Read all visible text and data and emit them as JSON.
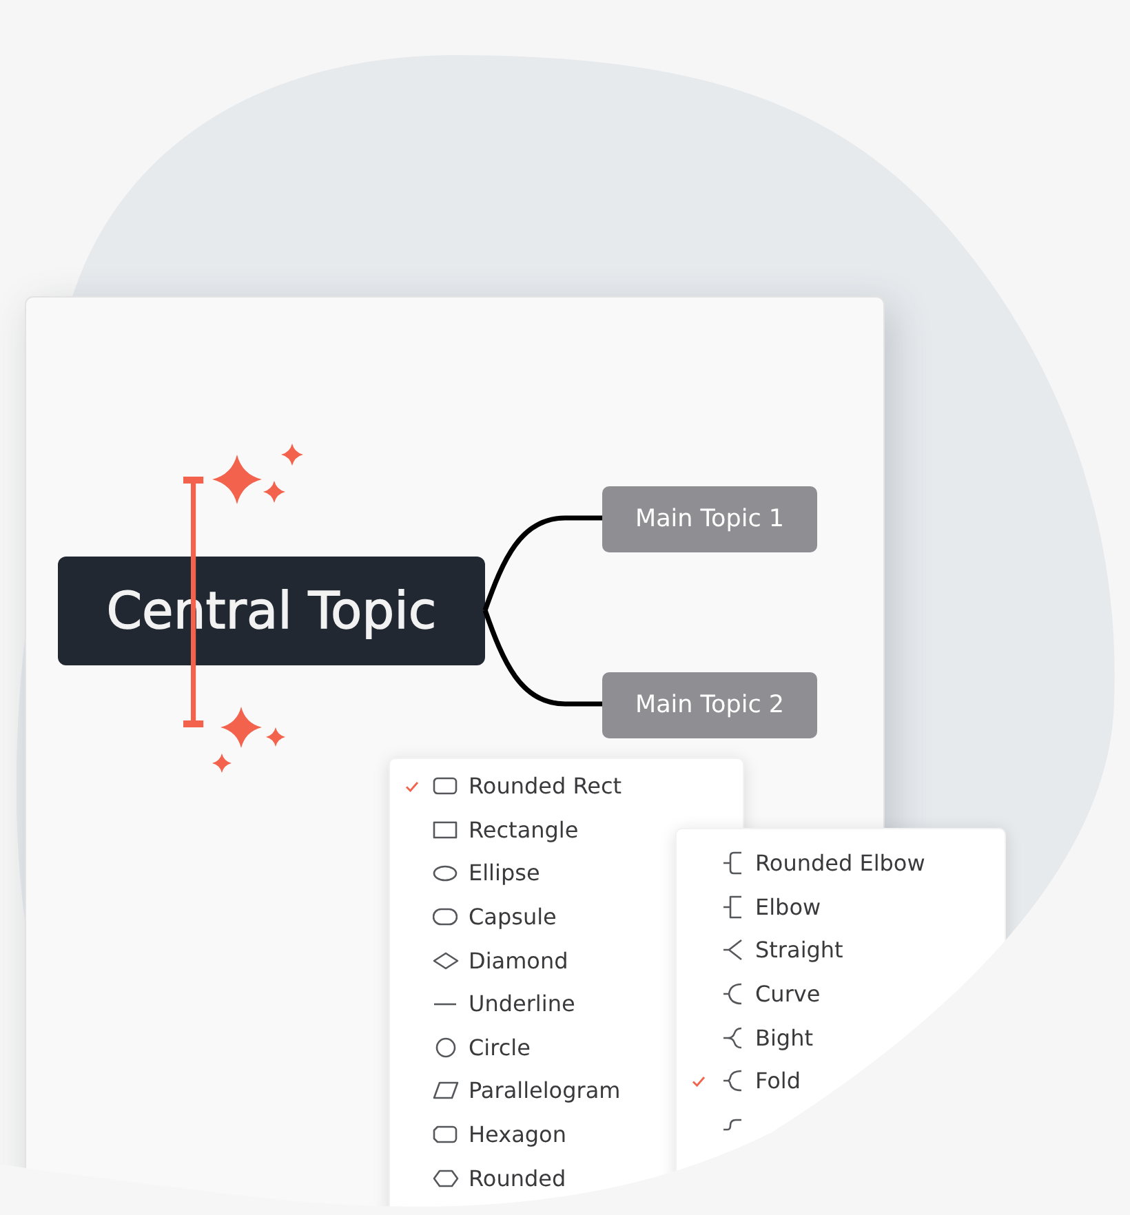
{
  "canvas": {
    "central_topic": {
      "label": "Central Topic"
    },
    "main_topics": [
      {
        "label": "Main Topic 1"
      },
      {
        "label": "Main Topic 2"
      }
    ]
  },
  "menus": [
    {
      "items": [
        {
          "label": "Rounded Rect",
          "kind": "roundrect",
          "selected": true
        },
        {
          "label": "Rectangle",
          "kind": "rect",
          "selected": false
        },
        {
          "label": "Ellipse",
          "kind": "ellipse",
          "selected": false
        },
        {
          "label": "Capsule",
          "kind": "capsule",
          "selected": false
        },
        {
          "label": "Diamond",
          "kind": "diamond",
          "selected": false
        },
        {
          "label": "Underline",
          "kind": "underline",
          "selected": false
        },
        {
          "label": "Circle",
          "kind": "circle",
          "selected": false
        },
        {
          "label": "Parallelogram",
          "kind": "parallelogram",
          "selected": false
        },
        {
          "label": "Hexagon",
          "kind": "hexagon",
          "selected": false
        },
        {
          "label": "Rounded",
          "kind": "roundhex",
          "selected": false
        }
      ]
    },
    {
      "items": [
        {
          "label": "Rounded Elbow",
          "kind": "roundelbow",
          "selected": false
        },
        {
          "label": "Elbow",
          "kind": "elbow",
          "selected": false
        },
        {
          "label": "Straight",
          "kind": "straight",
          "selected": false
        },
        {
          "label": "Curve",
          "kind": "curve",
          "selected": false
        },
        {
          "label": "Bight",
          "kind": "bight",
          "selected": false
        },
        {
          "label": "Fold",
          "kind": "fold",
          "selected": true
        },
        {
          "kind": "step",
          "selected": false
        }
      ]
    }
  ]
}
